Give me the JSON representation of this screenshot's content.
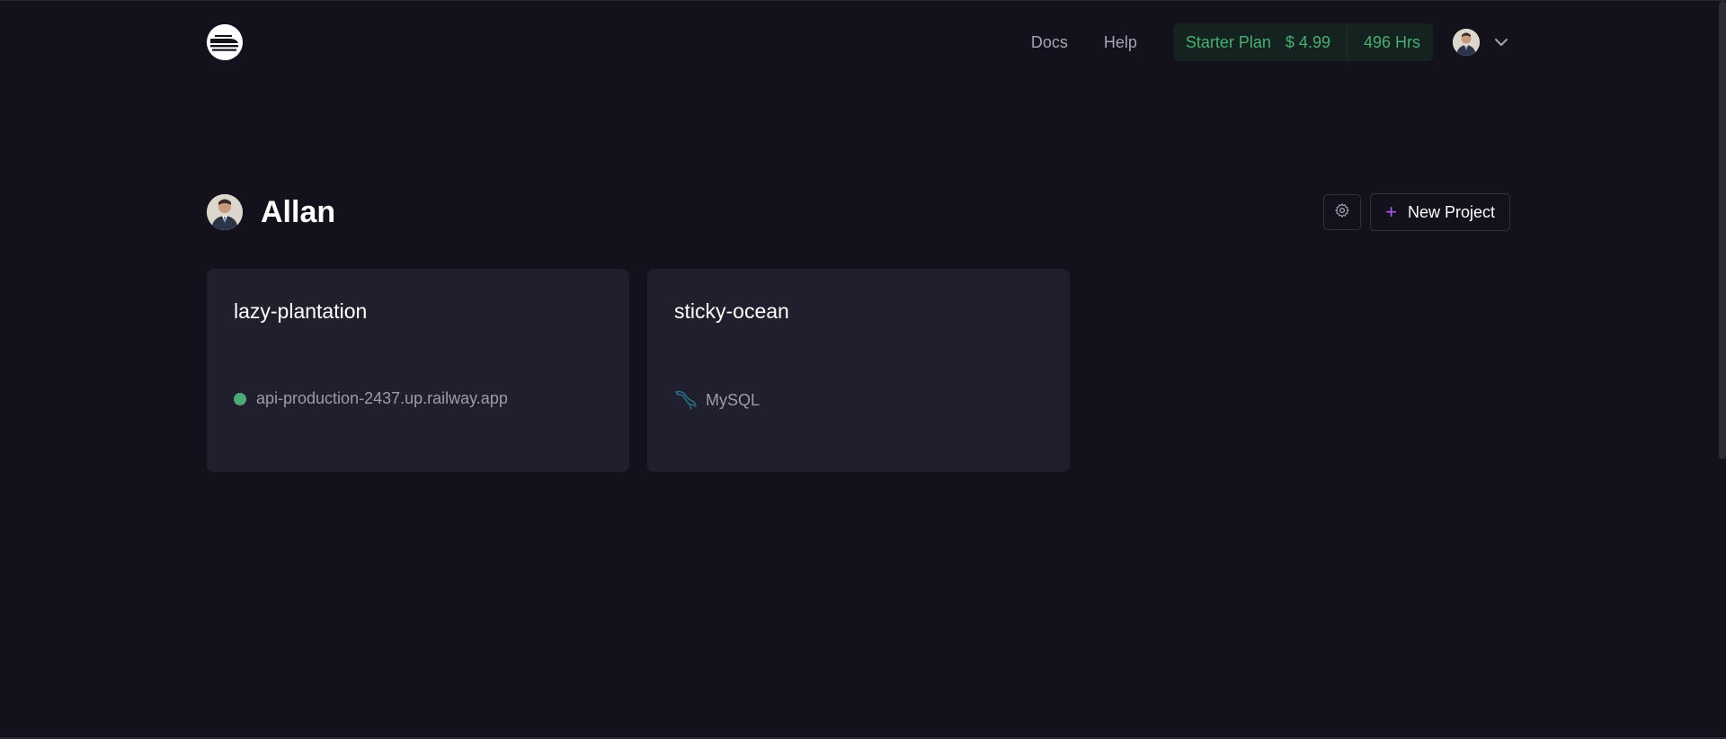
{
  "header": {
    "logo_icon": "railway-train-logo-icon",
    "nav": {
      "docs_label": "Docs",
      "help_label": "Help"
    },
    "plan": {
      "name": "Starter Plan",
      "amount": "$ 4.99",
      "hours": "496 Hrs",
      "color": "#4bae72"
    },
    "user_menu_icon": "chevron-down-icon"
  },
  "profile": {
    "name": "Allan",
    "settings_icon": "gear-icon",
    "new_project_label": "New Project",
    "accent_color": "#b05cf2"
  },
  "projects": [
    {
      "name": "lazy-plantation",
      "service": "api-production-2437.up.railway.app",
      "status_color": "#4ea879"
    },
    {
      "name": "sticky-ocean",
      "service": "MySQL",
      "service_icon": "mysql-dolphin-icon"
    }
  ]
}
